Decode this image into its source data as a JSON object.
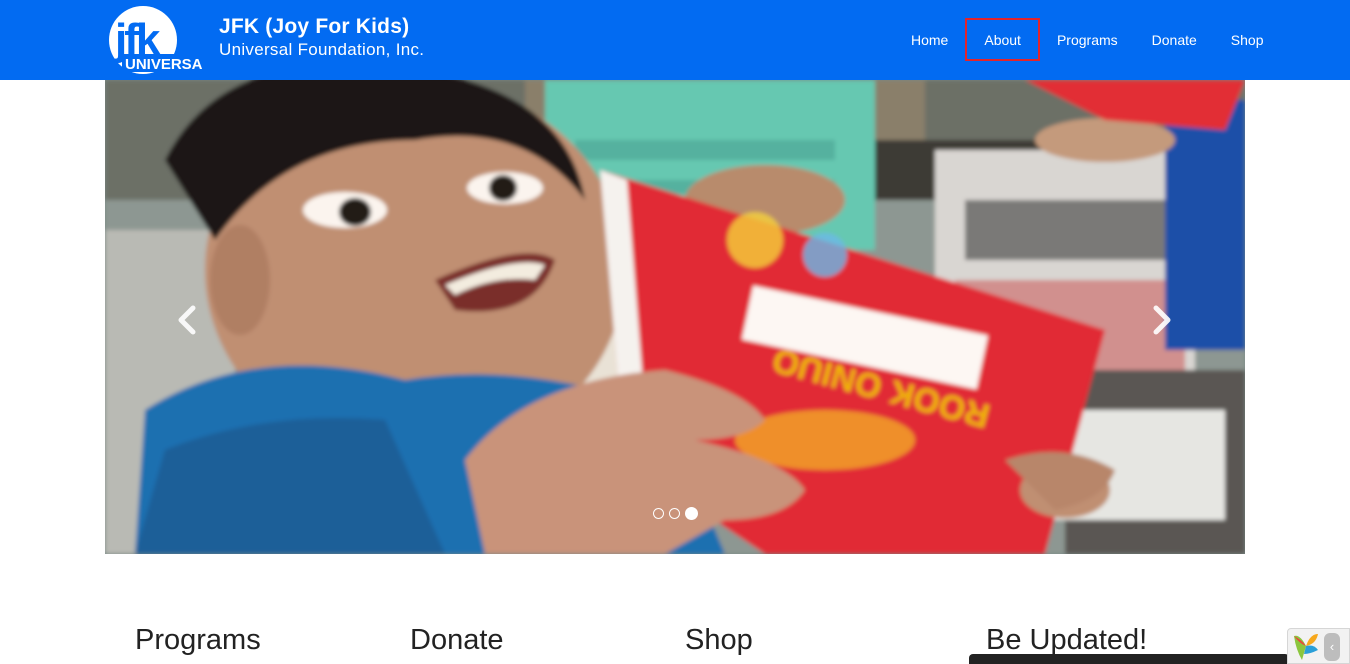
{
  "header": {
    "logo_text": "jfk UNIVERSAL",
    "brand_title": "JFK (Joy For Kids)",
    "brand_subtitle": "Universal Foundation, Inc."
  },
  "nav": {
    "items": [
      {
        "label": "Home"
      },
      {
        "label": "About",
        "active": true
      },
      {
        "label": "Programs"
      },
      {
        "label": "Donate"
      },
      {
        "label": "Shop"
      }
    ]
  },
  "carousel": {
    "slide_count": 3,
    "active_slide": 3,
    "prev_icon": "chevron-left-icon",
    "next_icon": "chevron-right-icon"
  },
  "sections": {
    "programs": "Programs",
    "donate": "Donate",
    "shop": "Shop",
    "updated": "Be Updated!"
  },
  "colors": {
    "navbar": "#026bf2",
    "active_outline": "#e3242b"
  }
}
